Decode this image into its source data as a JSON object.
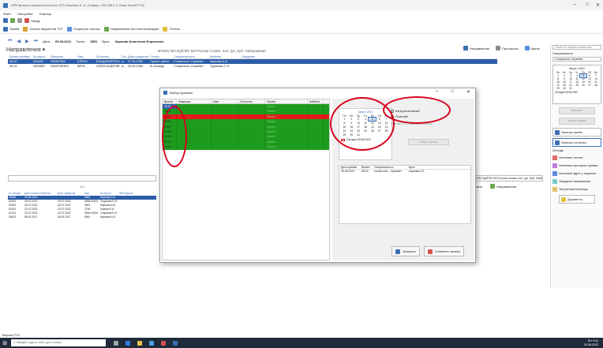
{
  "window": {
    "title": "АРМ Врача стоматологического ЛПУ, Карпова А. А. (Сервер: 192.168.0.1, База: stomFIT13)",
    "menu": [
      "Файл",
      "Настройки",
      "Помощь"
    ]
  },
  "toolbar1": {
    "items": [
      "Назад"
    ]
  },
  "toolbar2": {
    "items": [
      "Приём",
      "Список пациентов \"ЕЗ\"",
      "Открытые талоны",
      "Направления на госпитализацию",
      "Отчеты"
    ]
  },
  "navbar": {
    "date_label": "Дата:",
    "date_value": "05.08.2022",
    "talon_label": "Талон:",
    "talon_value": "5551",
    "doctor_label": "Врач:",
    "doctor_value": "Карпова Анастасия Борисовна"
  },
  "section_title": "Направления",
  "center_title": "ФГБОУ ВО КубГМУ МЗ России стомат. пол. (ул. Куб. Набережная",
  "right_actions": [
    "Направление",
    "Протоколы",
    "Карты"
  ],
  "top_table": {
    "headers": [
      "Время приёма",
      "№ карты",
      "Фамилия",
      "Имя",
      "Отчество",
      "Пол",
      "Дата рождения",
      "Статус",
      "Специальность",
      "Кабинет",
      "Сведения"
    ],
    "rows": [
      [
        "08:00",
        "005465",
        "ЯКИМОВА",
        "ЕЛЕНА",
        "ВЛАДИМИРОВНА",
        "ж",
        "27.08.1983",
        "Принят ранее",
        "Стоматолог-терапевт",
        "Карпова А.А.",
        ""
      ],
      [
        "08:16",
        "0053862",
        "ГАМОЧЕНКО",
        "ВЕРА",
        "АЛЕКСАНДРОВНА",
        "ж",
        "20.08.1986",
        "В очереди",
        "Стоматолог-терапевт",
        "Туранова Т. Н.",
        ""
      ]
    ]
  },
  "right_panel": {
    "search_placeholder": "Поиск по первым символам",
    "spec_label": "Специальность",
    "spec_value": "Стоматолог-терапевт",
    "cal_month": "Август 2022",
    "cal_days": [
      "Пн",
      "Вт",
      "Ср",
      "Чт",
      "Пт",
      "Сб",
      "Вс"
    ],
    "cal_today": "Сегодня 05.08.2022",
    "btn_disabled1": "Вызвать",
    "btn_disabled2": "Начать приём",
    "btn_write": "Записать приём",
    "btn_record": "Записать на приём",
    "legend_title": "Легенда",
    "legend": [
      {
        "color": "#e26a6a",
        "label": "Неполные талоны"
      },
      {
        "color": "#c07ad8",
        "label": "Неполные протоколы приёма"
      },
      {
        "color": "#5b8ee0",
        "label": "Неполный адрес у пациента"
      },
      {
        "color": "#7acbc9",
        "label": "Ожидание направления"
      },
      {
        "color": "#e3c26a",
        "label": "Экстренная больница"
      }
    ],
    "btn_docs": "Документы"
  },
  "middle": {
    "combo": "ФГБОУ ВО КубГМУ МЗ России стомат. пол. (ул. Куб. Набережная)",
    "tools": [
      "Печать",
      "Направления"
    ],
    "nav": "1/4"
  },
  "bottom_table": {
    "headers": [
      "№ талона",
      "Дата начала лечения",
      "Дата закрытия",
      "Код",
      "№ Булон",
      "ФИО врача"
    ],
    "rows": [
      [
        "48365",
        "05.08.2022",
        "",
        "5551",
        "Карпова А.Б.",
        ""
      ],
      [
        "01814",
        "29.07.2022",
        "29.07.2022",
        "0836.00001",
        "Тогушева Е.И.",
        ""
      ],
      [
        "01592",
        "25.07.2022",
        "25.07.2022",
        "5551",
        "Карпова А.Б.",
        ""
      ],
      [
        "01153",
        "22.07.2022",
        "22.07.2022",
        "3790",
        "Карпов Е.И.",
        ""
      ],
      [
        "01213",
        "22.07.2022",
        "22.07.2022",
        "0836.00001",
        "Тогушева Е.И.",
        ""
      ],
      [
        "09432",
        "08.02.2017",
        "08.02.2017",
        "5551",
        "Карпова А.Б.",
        ""
      ]
    ]
  },
  "statusbar": "Версия FTV",
  "taskbar": {
    "search_placeholder": "Введите здесь текст для поиска",
    "tray_line1": "RU",
    "tray_time": "9:33",
    "tray_date": "05.08.2022"
  },
  "dialog": {
    "title": "Выбор времени",
    "grid_headers": [
      "Время",
      "Фамилия",
      "Имя",
      "Отчество",
      "Приём",
      "Кабинет"
    ],
    "grid_rows": [
      {
        "time": "08:00",
        "status": "Занято",
        "color": "green"
      },
      {
        "time": "08:15",
        "status": "Занято",
        "color": "green"
      },
      {
        "time": "08:30",
        "status": "Занято",
        "color": "red"
      },
      {
        "time": "08:45",
        "status": "Занято",
        "color": "green"
      },
      {
        "time": "09:00",
        "status": "Занято",
        "color": "green"
      },
      {
        "time": "09:15",
        "status": "Занято",
        "color": "green"
      },
      {
        "time": "09:30",
        "status": "Занято",
        "color": "green"
      },
      {
        "time": "09:45",
        "status": "Занято",
        "color": "green"
      },
      {
        "time": "10:00",
        "status": "Занято",
        "color": "green"
      }
    ],
    "cal_month": "Август 2022",
    "cal_days": [
      "Пн",
      "Вт",
      "Ср",
      "Чт",
      "Пт",
      "Сб",
      "Вс"
    ],
    "cal_today": "Сегодня 05.08.2022",
    "radio1": "Консультативный",
    "radio2": "Платный",
    "mini_info": "Карпова А. Б. Стоматолог-терапевт",
    "mini_btn": "Начать приём",
    "appt_headers": [
      "Дата приёма",
      "Время",
      "Специальность",
      "Врач"
    ],
    "appt_row": [
      "05.08.2022",
      "08:00",
      "стоматолог - терапевт",
      "Карпова А.Б."
    ],
    "btn_save": "Записать",
    "btn_cancel": "Отменить запись"
  }
}
